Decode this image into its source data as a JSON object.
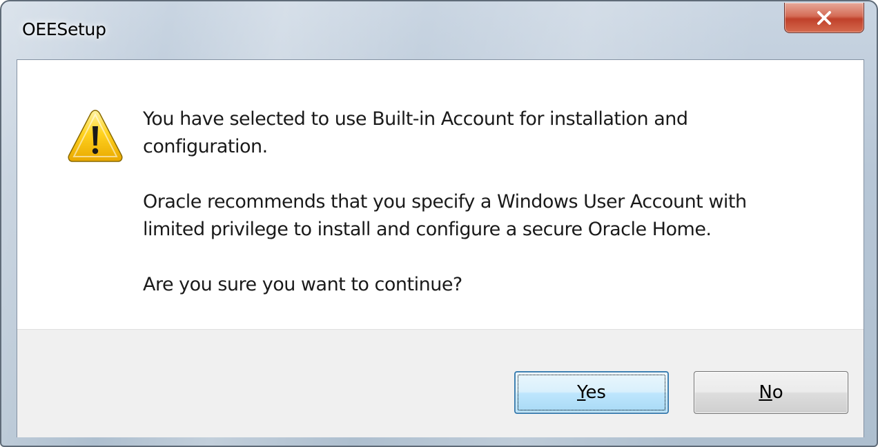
{
  "window": {
    "title": "OEESetup"
  },
  "dialog": {
    "icon": "warning-icon",
    "messages": [
      "You have selected to use Built-in Account for installation and\nconfiguration.",
      "Oracle recommends that you specify a Windows User Account with\nlimited privilege to install and configure a secure Oracle Home.",
      "Are you sure you want to continue?"
    ]
  },
  "buttons": {
    "yes": {
      "mnemonic": "Y",
      "rest": "es"
    },
    "no": {
      "mnemonic": "N",
      "rest": "o"
    },
    "close_icon": "close-icon"
  },
  "colors": {
    "close_button": "#c8482f",
    "focus_button": "#3c7fb1",
    "warning_fill": "#f5c400"
  }
}
